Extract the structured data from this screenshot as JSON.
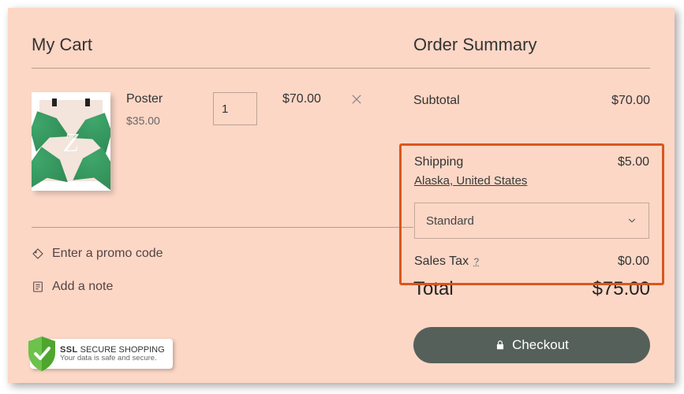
{
  "cart": {
    "title": "My Cart",
    "items": [
      {
        "name": "Poster",
        "unit_price": "$35.00",
        "quantity": "1",
        "line_total": "$70.00",
        "thumb_letter": "Z"
      }
    ],
    "promo_label": "Enter a promo code",
    "note_label": "Add a note"
  },
  "ssl": {
    "line1_bold": "SSL",
    "line1_rest": "SECURE SHOPPING",
    "line2": "Your data is safe and secure."
  },
  "summary": {
    "title": "Order Summary",
    "subtotal_label": "Subtotal",
    "subtotal_value": "$70.00",
    "shipping_label": "Shipping",
    "shipping_value": "$5.00",
    "shipping_destination": "Alaska, United States",
    "shipping_method": "Standard",
    "tax_label": "Sales Tax",
    "tax_help": "?",
    "tax_value": "$0.00",
    "total_label": "Total",
    "total_value": "$75.00",
    "checkout_label": "Checkout"
  },
  "colors": {
    "page_bg": "#fcd7c6",
    "highlight_border": "#d8571c",
    "checkout_bg": "#56605b"
  }
}
